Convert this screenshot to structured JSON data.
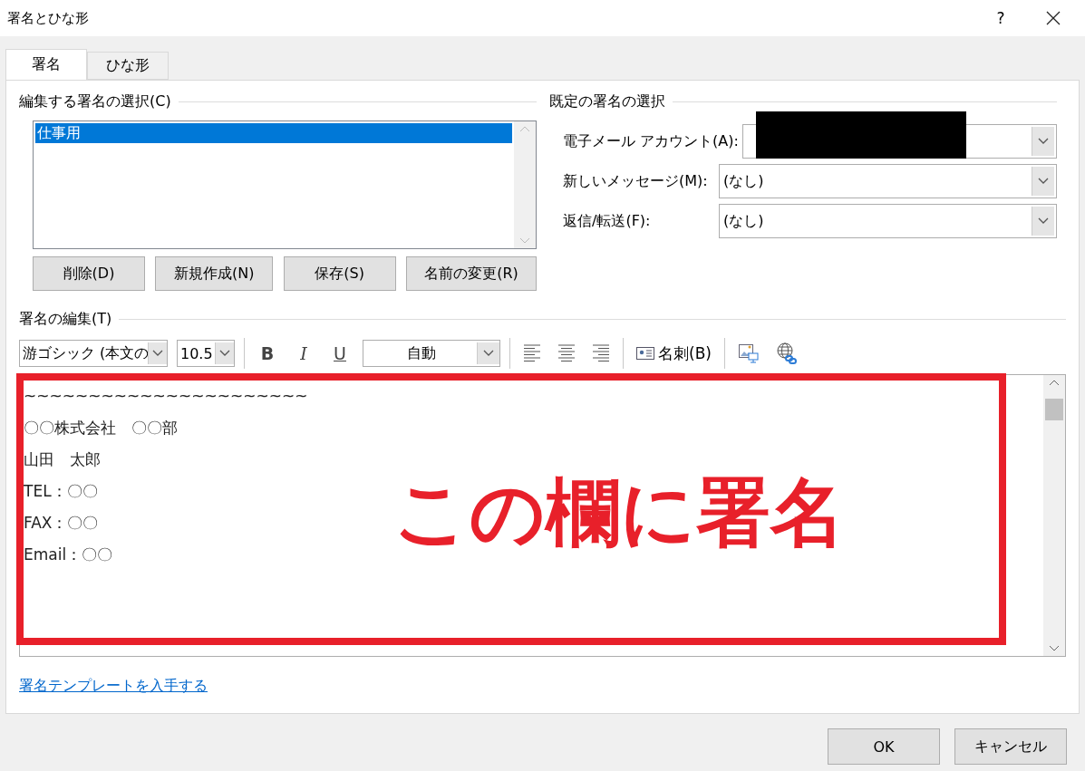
{
  "window": {
    "title": "署名とひな形",
    "help": "?"
  },
  "tabs": [
    {
      "label": "署名",
      "selected": true
    },
    {
      "label": "ひな形",
      "selected": false
    }
  ],
  "edit_select": {
    "heading": "編集する署名の選択(C)",
    "items": [
      {
        "label": "仕事用",
        "selected": true
      }
    ],
    "buttons": [
      "削除(D)",
      "新規作成(N)",
      "保存(S)",
      "名前の変更(R)"
    ]
  },
  "defaults": {
    "heading": "既定の署名の選択",
    "fields": [
      {
        "label": "電子メール アカウント(A):",
        "redacted": true
      },
      {
        "label": "新しいメッセージ(M):",
        "value": "(なし)",
        "redacted": false
      },
      {
        "label": "返信/転送(F):",
        "value": "(なし)",
        "redacted": false
      }
    ]
  },
  "editor": {
    "heading": "署名の編集(T)",
    "font": "游ゴシック (本文の",
    "size": "10.5",
    "font_color_label": "自動",
    "format_buttons": [
      {
        "label": "B",
        "kind": "bold"
      },
      {
        "label": "I",
        "kind": "italic"
      },
      {
        "label": "U",
        "kind": "underline"
      }
    ],
    "business_card": "名刺(B)",
    "lines": [
      "~~~~~~~~~~~~~~~~~~~~~~",
      "〇〇株式会社　〇〇部",
      "山田　太郎",
      "TEL：〇〇",
      "FAX：〇〇",
      "Email：〇〇"
    ],
    "annotation": "この欄に署名"
  },
  "template_link": "署名テンプレートを入手する",
  "footer_buttons": [
    "OK",
    "キャンセル"
  ]
}
